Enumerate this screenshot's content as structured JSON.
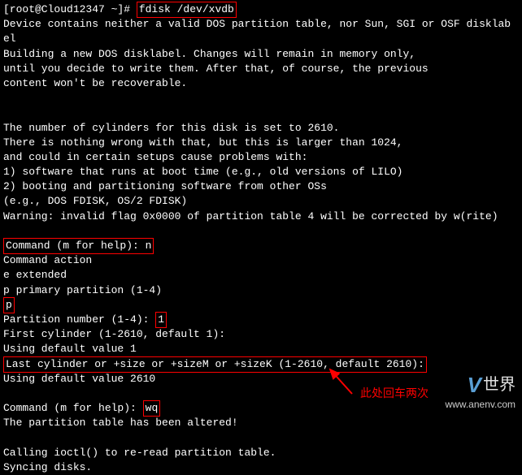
{
  "terminal": {
    "prompt": "[root@Cloud12347 ~]# ",
    "command": "fdisk /dev/xvdb",
    "output1": "Device contains neither a valid DOS partition table, nor Sun, SGI or OSF disklab",
    "output2": "el",
    "output3": "Building a new DOS disklabel. Changes will remain in memory only,",
    "output4": "until you decide to write them. After that, of course, the previous",
    "output5": "content won't be recoverable.",
    "blank": " ",
    "cyl1": "The number of cylinders for this disk is set to 2610.",
    "cyl2": "There is nothing wrong with that, but this is larger than 1024,",
    "cyl3": "and could in certain setups cause problems with:",
    "cyl4": "1) software that runs at boot time (e.g., old versions of LILO)",
    "cyl5": "2) booting and partitioning software from other OSs",
    "cyl6": "   (e.g., DOS FDISK, OS/2 FDISK)",
    "warning": "Warning: invalid flag 0x0000 of partition table 4 will be corrected by w(rite)",
    "cmd_prompt1": "Command (m for help): ",
    "cmd_input1": "n",
    "action1": "Command action",
    "action2": "   e   extended",
    "action3": "   p   primary partition (1-4)",
    "partition_type": "p",
    "partnum_prompt": "Partition number (1-4): ",
    "partnum_input": "1",
    "firstcyl": "First cylinder (1-2610, default 1):",
    "usingdefault1": "Using default value 1",
    "lastcyl": "Last cylinder or +size or +sizeM or +sizeK (1-2610, default 2610):",
    "usingdefault2": "Using default value 2610",
    "cmd_prompt2": "Command (m for help): ",
    "cmd_input2": "wq",
    "altered": "The partition table has been altered!",
    "calling": "Calling ioctl() to re-read partition table.",
    "syncing": "Syncing disks."
  },
  "annotation": {
    "text": "此处回车两次"
  },
  "watermark": {
    "logo_v": "V",
    "logo_text": "世界",
    "url": "www.anenv.com"
  }
}
